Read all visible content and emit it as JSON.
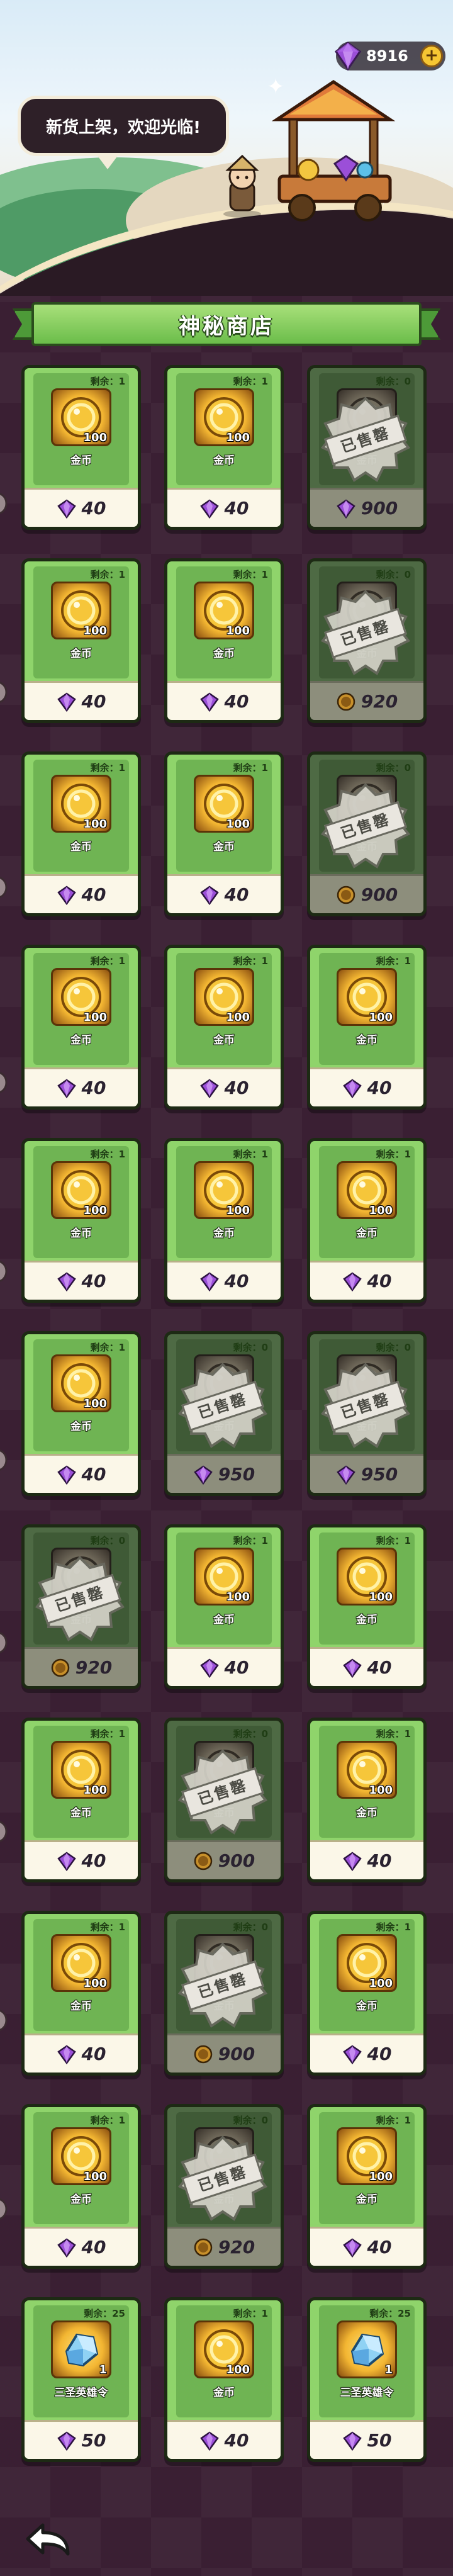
{
  "header": {
    "gem_count": "8916",
    "plus_label": "+",
    "speech": "新货上架，欢迎光临!"
  },
  "shop": {
    "title": "神秘商店",
    "remain_prefix": "剩余：",
    "sold_label": "已售罄",
    "items": [
      {
        "name": "金币",
        "qty": "100",
        "remain": "1",
        "currency": "gem",
        "price": "40",
        "sold": false,
        "icon": "coin"
      },
      {
        "name": "金币",
        "qty": "100",
        "remain": "1",
        "currency": "gem",
        "price": "40",
        "sold": false,
        "icon": "coin"
      },
      {
        "name": "金币",
        "qty": "100",
        "remain": "0",
        "currency": "gem",
        "price": "900",
        "sold": true,
        "icon": "coin"
      },
      {
        "name": "金币",
        "qty": "100",
        "remain": "1",
        "currency": "gem",
        "price": "40",
        "sold": false,
        "icon": "coin"
      },
      {
        "name": "金币",
        "qty": "100",
        "remain": "1",
        "currency": "gem",
        "price": "40",
        "sold": false,
        "icon": "coin"
      },
      {
        "name": "金币",
        "qty": "100",
        "remain": "0",
        "currency": "coin",
        "price": "920",
        "sold": true,
        "icon": "coin"
      },
      {
        "name": "金币",
        "qty": "100",
        "remain": "1",
        "currency": "gem",
        "price": "40",
        "sold": false,
        "icon": "coin"
      },
      {
        "name": "金币",
        "qty": "100",
        "remain": "1",
        "currency": "gem",
        "price": "40",
        "sold": false,
        "icon": "coin"
      },
      {
        "name": "金币",
        "qty": "100",
        "remain": "0",
        "currency": "coin",
        "price": "900",
        "sold": true,
        "icon": "coin"
      },
      {
        "name": "金币",
        "qty": "100",
        "remain": "1",
        "currency": "gem",
        "price": "40",
        "sold": false,
        "icon": "coin"
      },
      {
        "name": "金币",
        "qty": "100",
        "remain": "1",
        "currency": "gem",
        "price": "40",
        "sold": false,
        "icon": "coin"
      },
      {
        "name": "金币",
        "qty": "100",
        "remain": "1",
        "currency": "gem",
        "price": "40",
        "sold": false,
        "icon": "coin"
      },
      {
        "name": "金币",
        "qty": "100",
        "remain": "1",
        "currency": "gem",
        "price": "40",
        "sold": false,
        "icon": "coin"
      },
      {
        "name": "金币",
        "qty": "100",
        "remain": "1",
        "currency": "gem",
        "price": "40",
        "sold": false,
        "icon": "coin"
      },
      {
        "name": "金币",
        "qty": "100",
        "remain": "1",
        "currency": "gem",
        "price": "40",
        "sold": false,
        "icon": "coin"
      },
      {
        "name": "金币",
        "qty": "100",
        "remain": "1",
        "currency": "gem",
        "price": "40",
        "sold": false,
        "icon": "coin"
      },
      {
        "name": "金币",
        "qty": "100",
        "remain": "0",
        "currency": "gem",
        "price": "950",
        "sold": true,
        "icon": "coin"
      },
      {
        "name": "金币",
        "qty": "100",
        "remain": "0",
        "currency": "gem",
        "price": "950",
        "sold": true,
        "icon": "coin"
      },
      {
        "name": "金币",
        "qty": "100",
        "remain": "0",
        "currency": "coin",
        "price": "920",
        "sold": true,
        "icon": "coin"
      },
      {
        "name": "金币",
        "qty": "100",
        "remain": "1",
        "currency": "gem",
        "price": "40",
        "sold": false,
        "icon": "coin"
      },
      {
        "name": "金币",
        "qty": "100",
        "remain": "1",
        "currency": "gem",
        "price": "40",
        "sold": false,
        "icon": "coin"
      },
      {
        "name": "金币",
        "qty": "100",
        "remain": "1",
        "currency": "gem",
        "price": "40",
        "sold": false,
        "icon": "coin"
      },
      {
        "name": "金币",
        "qty": "100",
        "remain": "0",
        "currency": "coin",
        "price": "900",
        "sold": true,
        "icon": "coin"
      },
      {
        "name": "金币",
        "qty": "100",
        "remain": "1",
        "currency": "gem",
        "price": "40",
        "sold": false,
        "icon": "coin"
      },
      {
        "name": "金币",
        "qty": "100",
        "remain": "1",
        "currency": "gem",
        "price": "40",
        "sold": false,
        "icon": "coin"
      },
      {
        "name": "金币",
        "qty": "100",
        "remain": "0",
        "currency": "coin",
        "price": "900",
        "sold": true,
        "icon": "coin"
      },
      {
        "name": "金币",
        "qty": "100",
        "remain": "1",
        "currency": "gem",
        "price": "40",
        "sold": false,
        "icon": "coin"
      },
      {
        "name": "金币",
        "qty": "100",
        "remain": "1",
        "currency": "gem",
        "price": "40",
        "sold": false,
        "icon": "coin"
      },
      {
        "name": "金币",
        "qty": "100",
        "remain": "0",
        "currency": "coin",
        "price": "920",
        "sold": true,
        "icon": "coin"
      },
      {
        "name": "金币",
        "qty": "100",
        "remain": "1",
        "currency": "gem",
        "price": "40",
        "sold": false,
        "icon": "coin"
      },
      {
        "name": "三圣英雄令",
        "qty": "1",
        "remain": "25",
        "currency": "gem",
        "price": "50",
        "sold": false,
        "icon": "hero-token"
      },
      {
        "name": "金币",
        "qty": "100",
        "remain": "1",
        "currency": "gem",
        "price": "40",
        "sold": false,
        "icon": "coin"
      },
      {
        "name": "三圣英雄令",
        "qty": "1",
        "remain": "25",
        "currency": "gem",
        "price": "50",
        "sold": false,
        "icon": "hero-token"
      }
    ]
  },
  "colors": {
    "background": "#3a1f33",
    "card_green": "#8fd46b",
    "card_sold": "#4e6a44",
    "gem_purple": "#9b4fd8",
    "coin_gold": "#f3b632"
  },
  "icons": {
    "gem": "purple-gem-icon",
    "coin": "gold-coin-icon",
    "hero_token": "crystal-shard-icon",
    "back": "back-arrow-icon"
  }
}
